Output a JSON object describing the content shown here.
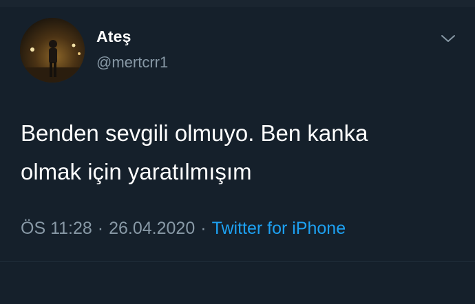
{
  "user": {
    "display_name": "Ateş",
    "username": "@mertcrr1"
  },
  "tweet": {
    "text": "Benden sevgili olmuyo. Ben kanka\nolmak için yaratılmışım",
    "time": "ÖS 11:28",
    "date": "26.04.2020",
    "separator": "·",
    "source": "Twitter for iPhone"
  },
  "icons": {
    "more": "chevron-down-icon"
  },
  "colors": {
    "background": "#15202b",
    "text_primary": "#ffffff",
    "text_secondary": "#8899a6",
    "accent": "#1da1f2"
  }
}
